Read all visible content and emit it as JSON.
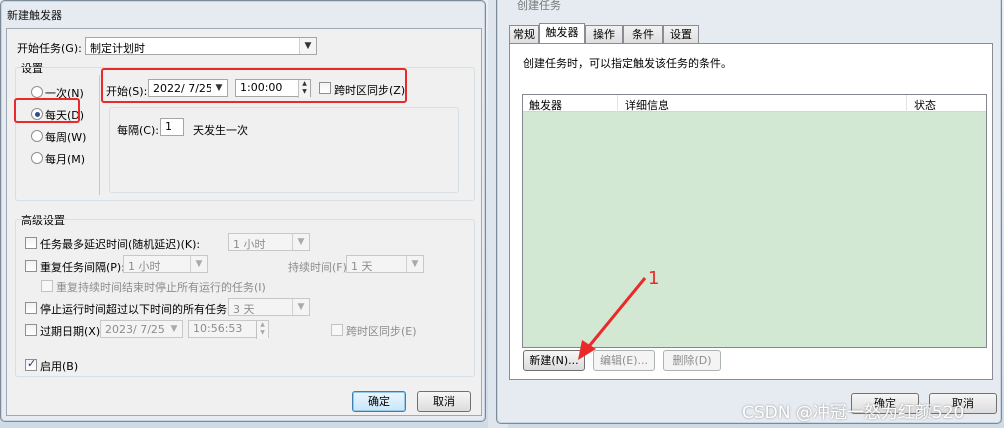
{
  "left": {
    "title": "新建触发器",
    "begin_task_label": "开始任务(G):",
    "begin_task_value": "制定计划时",
    "settings_label": "设置",
    "schedule_options": [
      "一次(N)",
      "每天(D)",
      "每周(W)",
      "每月(M)"
    ],
    "start_label": "开始(S):",
    "start_date": "2022/  7/25",
    "start_time": "1:00:00",
    "sync_tz_label": "跨时区同步(Z)",
    "recur_label": "每隔(C):",
    "recur_value": "1",
    "recur_suffix": "天发生一次",
    "advanced_label": "高级设置",
    "delay_label": "任务最多延迟时间(随机延迟)(K):",
    "delay_value": "1 小时",
    "repeat_label": "重复任务间隔(P):",
    "repeat_value": "1 小时",
    "duration_label": "持续时间(F):",
    "duration_value": "1 天",
    "stop_all_label": "重复持续时间结束时停止所有运行的任务(I)",
    "stop_long_label": "停止运行时间超过以下时间的所有任务(L):",
    "stop_long_value": "3 天",
    "expire_label": "过期日期(X):",
    "expire_date": "2023/  7/25",
    "expire_time": "10:56:53",
    "expire_sync_label": "跨时区同步(E)",
    "enabled_label": "启用(B)",
    "ok_label": "确定",
    "cancel_label": "取消"
  },
  "right": {
    "title": "创建任务",
    "tabs": [
      "常规",
      "触发器",
      "操作",
      "条件",
      "设置"
    ],
    "description": "创建任务时，可以指定触发该任务的条件。",
    "columns": [
      "触发器",
      "详细信息",
      "状态"
    ],
    "new_label": "新建(N)...",
    "edit_label": "编辑(E)...",
    "delete_label": "删除(D)",
    "ok_label": "确定",
    "cancel_label": "取消",
    "annotation_number": "1"
  },
  "watermark": "CSDN @冲冠一怒为红颜520",
  "colors": {
    "highlight_red": "#ea2a2a",
    "list_bg": "#d2e8d2",
    "default_button": "#3c7fb1"
  }
}
